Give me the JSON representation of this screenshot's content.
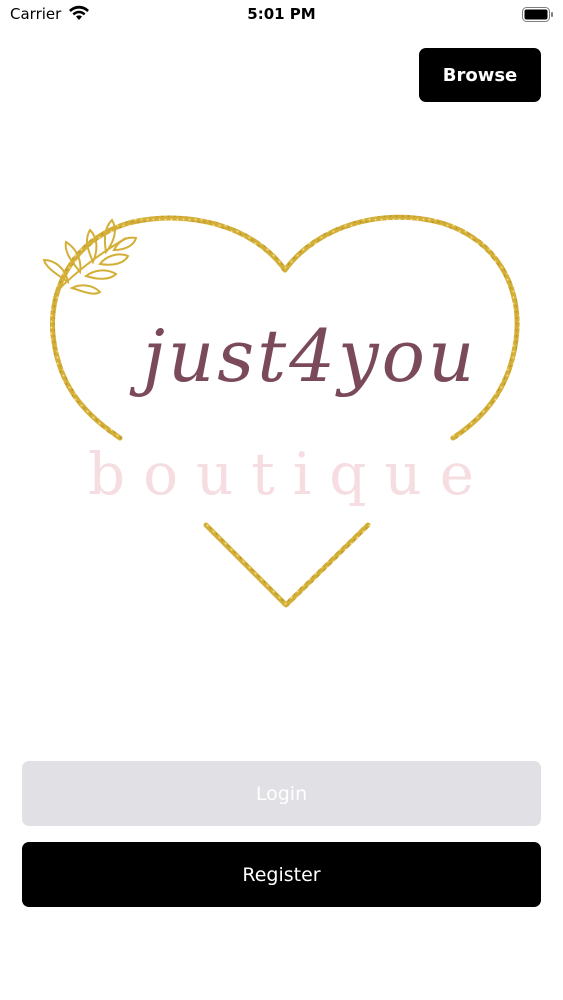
{
  "status_bar": {
    "carrier": "Carrier",
    "time": "5:01 PM",
    "icons": [
      "wifi-icon",
      "battery-icon"
    ]
  },
  "header": {
    "browse_label": "Browse"
  },
  "logo": {
    "script_text": "just4you",
    "sub_text": "boutique",
    "colors": {
      "script": "#7b4a5a",
      "sub": "#f5dde1",
      "gold": "#d4af37"
    }
  },
  "actions": {
    "login_label": "Login",
    "register_label": "Register"
  }
}
